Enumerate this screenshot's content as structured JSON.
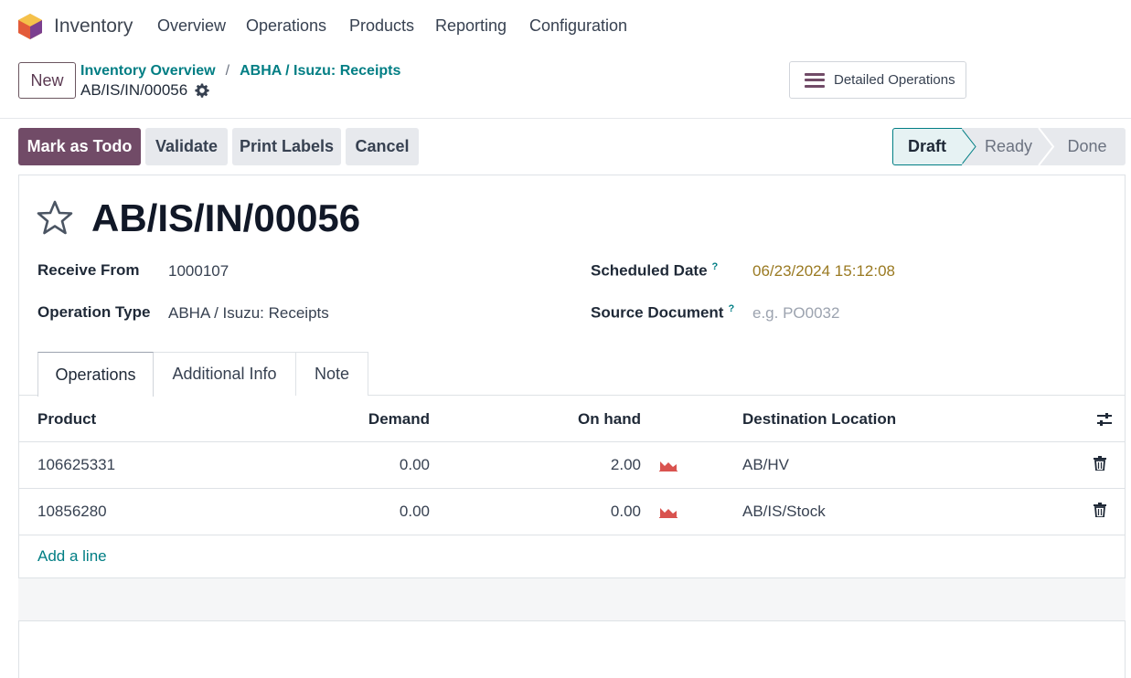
{
  "navbar": {
    "app_name": "Inventory",
    "menu": [
      "Overview",
      "Operations",
      "Products",
      "Reporting",
      "Configuration"
    ]
  },
  "control_panel": {
    "new_label": "New",
    "breadcrumb": [
      "Inventory Overview",
      "ABHA / Isuzu: Receipts"
    ],
    "breadcrumb_separator": "/",
    "record_ref": "AB/IS/IN/00056",
    "detailed_operations_label": "Detailed Operations"
  },
  "actions": {
    "mark_todo": "Mark as Todo",
    "validate": "Validate",
    "print_labels": "Print Labels",
    "cancel": "Cancel"
  },
  "status": {
    "steps": [
      "Draft",
      "Ready",
      "Done"
    ],
    "current": "Draft"
  },
  "form": {
    "title": "AB/IS/IN/00056",
    "receive_from_label": "Receive From",
    "receive_from_value": "1000107",
    "operation_type_label": "Operation Type",
    "operation_type_value": "ABHA / Isuzu: Receipts",
    "scheduled_date_label": "Scheduled Date",
    "scheduled_date_value": "06/23/2024 15:12:08",
    "source_document_label": "Source Document",
    "source_document_placeholder": "e.g. PO0032",
    "help_mark": "?"
  },
  "tabs": [
    "Operations",
    "Additional Info",
    "Note"
  ],
  "table": {
    "headers": {
      "product": "Product",
      "demand": "Demand",
      "on_hand": "On hand",
      "destination": "Destination Location"
    },
    "rows": [
      {
        "product": "106625331",
        "demand": "0.00",
        "on_hand": "2.00",
        "destination": "AB/HV"
      },
      {
        "product": "10856280",
        "demand": "0.00",
        "on_hand": "0.00",
        "destination": "AB/IS/Stock"
      }
    ],
    "add_line_label": "Add a line"
  },
  "colors": {
    "brand": "#714B67",
    "link": "#017e84",
    "forecast": "#d9534f",
    "date": "#9a7a22"
  }
}
